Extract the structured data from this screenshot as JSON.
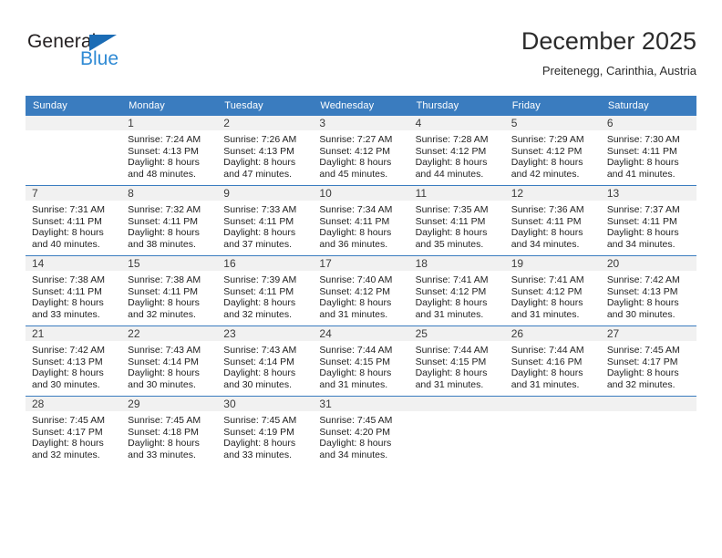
{
  "brand": {
    "name_top": "General",
    "name_bottom": "Blue",
    "triangle_color": "#1b6cb5",
    "blue_text_color": "#2f8ad4"
  },
  "header": {
    "title": "December 2025",
    "subtitle": "Preitenegg, Carinthia, Austria"
  },
  "theme": {
    "header_bar_color": "#3a7cbf",
    "daynum_band_color": "#f1f1f1",
    "cell_background": "#ffffff"
  },
  "weekday_headers": [
    "Sunday",
    "Monday",
    "Tuesday",
    "Wednesday",
    "Thursday",
    "Friday",
    "Saturday"
  ],
  "weeks": [
    [
      {
        "day": "",
        "sunrise": "",
        "sunset": "",
        "daylight_line1": "",
        "daylight_line2": ""
      },
      {
        "day": "1",
        "sunrise": "Sunrise: 7:24 AM",
        "sunset": "Sunset: 4:13 PM",
        "daylight_line1": "Daylight: 8 hours",
        "daylight_line2": "and 48 minutes."
      },
      {
        "day": "2",
        "sunrise": "Sunrise: 7:26 AM",
        "sunset": "Sunset: 4:13 PM",
        "daylight_line1": "Daylight: 8 hours",
        "daylight_line2": "and 47 minutes."
      },
      {
        "day": "3",
        "sunrise": "Sunrise: 7:27 AM",
        "sunset": "Sunset: 4:12 PM",
        "daylight_line1": "Daylight: 8 hours",
        "daylight_line2": "and 45 minutes."
      },
      {
        "day": "4",
        "sunrise": "Sunrise: 7:28 AM",
        "sunset": "Sunset: 4:12 PM",
        "daylight_line1": "Daylight: 8 hours",
        "daylight_line2": "and 44 minutes."
      },
      {
        "day": "5",
        "sunrise": "Sunrise: 7:29 AM",
        "sunset": "Sunset: 4:12 PM",
        "daylight_line1": "Daylight: 8 hours",
        "daylight_line2": "and 42 minutes."
      },
      {
        "day": "6",
        "sunrise": "Sunrise: 7:30 AM",
        "sunset": "Sunset: 4:11 PM",
        "daylight_line1": "Daylight: 8 hours",
        "daylight_line2": "and 41 minutes."
      }
    ],
    [
      {
        "day": "7",
        "sunrise": "Sunrise: 7:31 AM",
        "sunset": "Sunset: 4:11 PM",
        "daylight_line1": "Daylight: 8 hours",
        "daylight_line2": "and 40 minutes."
      },
      {
        "day": "8",
        "sunrise": "Sunrise: 7:32 AM",
        "sunset": "Sunset: 4:11 PM",
        "daylight_line1": "Daylight: 8 hours",
        "daylight_line2": "and 38 minutes."
      },
      {
        "day": "9",
        "sunrise": "Sunrise: 7:33 AM",
        "sunset": "Sunset: 4:11 PM",
        "daylight_line1": "Daylight: 8 hours",
        "daylight_line2": "and 37 minutes."
      },
      {
        "day": "10",
        "sunrise": "Sunrise: 7:34 AM",
        "sunset": "Sunset: 4:11 PM",
        "daylight_line1": "Daylight: 8 hours",
        "daylight_line2": "and 36 minutes."
      },
      {
        "day": "11",
        "sunrise": "Sunrise: 7:35 AM",
        "sunset": "Sunset: 4:11 PM",
        "daylight_line1": "Daylight: 8 hours",
        "daylight_line2": "and 35 minutes."
      },
      {
        "day": "12",
        "sunrise": "Sunrise: 7:36 AM",
        "sunset": "Sunset: 4:11 PM",
        "daylight_line1": "Daylight: 8 hours",
        "daylight_line2": "and 34 minutes."
      },
      {
        "day": "13",
        "sunrise": "Sunrise: 7:37 AM",
        "sunset": "Sunset: 4:11 PM",
        "daylight_line1": "Daylight: 8 hours",
        "daylight_line2": "and 34 minutes."
      }
    ],
    [
      {
        "day": "14",
        "sunrise": "Sunrise: 7:38 AM",
        "sunset": "Sunset: 4:11 PM",
        "daylight_line1": "Daylight: 8 hours",
        "daylight_line2": "and 33 minutes."
      },
      {
        "day": "15",
        "sunrise": "Sunrise: 7:38 AM",
        "sunset": "Sunset: 4:11 PM",
        "daylight_line1": "Daylight: 8 hours",
        "daylight_line2": "and 32 minutes."
      },
      {
        "day": "16",
        "sunrise": "Sunrise: 7:39 AM",
        "sunset": "Sunset: 4:11 PM",
        "daylight_line1": "Daylight: 8 hours",
        "daylight_line2": "and 32 minutes."
      },
      {
        "day": "17",
        "sunrise": "Sunrise: 7:40 AM",
        "sunset": "Sunset: 4:12 PM",
        "daylight_line1": "Daylight: 8 hours",
        "daylight_line2": "and 31 minutes."
      },
      {
        "day": "18",
        "sunrise": "Sunrise: 7:41 AM",
        "sunset": "Sunset: 4:12 PM",
        "daylight_line1": "Daylight: 8 hours",
        "daylight_line2": "and 31 minutes."
      },
      {
        "day": "19",
        "sunrise": "Sunrise: 7:41 AM",
        "sunset": "Sunset: 4:12 PM",
        "daylight_line1": "Daylight: 8 hours",
        "daylight_line2": "and 31 minutes."
      },
      {
        "day": "20",
        "sunrise": "Sunrise: 7:42 AM",
        "sunset": "Sunset: 4:13 PM",
        "daylight_line1": "Daylight: 8 hours",
        "daylight_line2": "and 30 minutes."
      }
    ],
    [
      {
        "day": "21",
        "sunrise": "Sunrise: 7:42 AM",
        "sunset": "Sunset: 4:13 PM",
        "daylight_line1": "Daylight: 8 hours",
        "daylight_line2": "and 30 minutes."
      },
      {
        "day": "22",
        "sunrise": "Sunrise: 7:43 AM",
        "sunset": "Sunset: 4:14 PM",
        "daylight_line1": "Daylight: 8 hours",
        "daylight_line2": "and 30 minutes."
      },
      {
        "day": "23",
        "sunrise": "Sunrise: 7:43 AM",
        "sunset": "Sunset: 4:14 PM",
        "daylight_line1": "Daylight: 8 hours",
        "daylight_line2": "and 30 minutes."
      },
      {
        "day": "24",
        "sunrise": "Sunrise: 7:44 AM",
        "sunset": "Sunset: 4:15 PM",
        "daylight_line1": "Daylight: 8 hours",
        "daylight_line2": "and 31 minutes."
      },
      {
        "day": "25",
        "sunrise": "Sunrise: 7:44 AM",
        "sunset": "Sunset: 4:15 PM",
        "daylight_line1": "Daylight: 8 hours",
        "daylight_line2": "and 31 minutes."
      },
      {
        "day": "26",
        "sunrise": "Sunrise: 7:44 AM",
        "sunset": "Sunset: 4:16 PM",
        "daylight_line1": "Daylight: 8 hours",
        "daylight_line2": "and 31 minutes."
      },
      {
        "day": "27",
        "sunrise": "Sunrise: 7:45 AM",
        "sunset": "Sunset: 4:17 PM",
        "daylight_line1": "Daylight: 8 hours",
        "daylight_line2": "and 32 minutes."
      }
    ],
    [
      {
        "day": "28",
        "sunrise": "Sunrise: 7:45 AM",
        "sunset": "Sunset: 4:17 PM",
        "daylight_line1": "Daylight: 8 hours",
        "daylight_line2": "and 32 minutes."
      },
      {
        "day": "29",
        "sunrise": "Sunrise: 7:45 AM",
        "sunset": "Sunset: 4:18 PM",
        "daylight_line1": "Daylight: 8 hours",
        "daylight_line2": "and 33 minutes."
      },
      {
        "day": "30",
        "sunrise": "Sunrise: 7:45 AM",
        "sunset": "Sunset: 4:19 PM",
        "daylight_line1": "Daylight: 8 hours",
        "daylight_line2": "and 33 minutes."
      },
      {
        "day": "31",
        "sunrise": "Sunrise: 7:45 AM",
        "sunset": "Sunset: 4:20 PM",
        "daylight_line1": "Daylight: 8 hours",
        "daylight_line2": "and 34 minutes."
      },
      {
        "day": "",
        "sunrise": "",
        "sunset": "",
        "daylight_line1": "",
        "daylight_line2": ""
      },
      {
        "day": "",
        "sunrise": "",
        "sunset": "",
        "daylight_line1": "",
        "daylight_line2": ""
      },
      {
        "day": "",
        "sunrise": "",
        "sunset": "",
        "daylight_line1": "",
        "daylight_line2": ""
      }
    ]
  ]
}
